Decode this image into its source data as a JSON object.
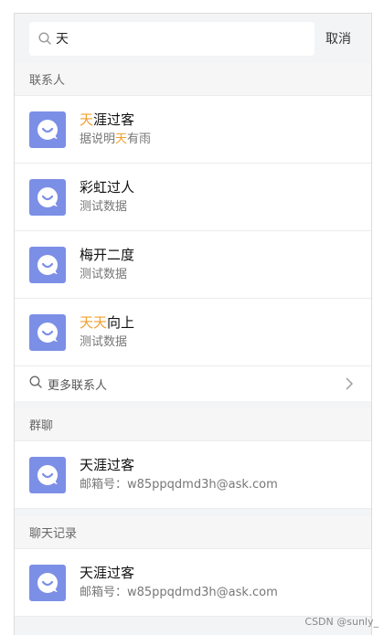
{
  "search": {
    "value": "天",
    "cancel_label": "取消"
  },
  "sections": {
    "contacts": {
      "title": "联系人",
      "more_label": "更多联系人"
    },
    "groups": {
      "title": "群聊"
    },
    "history": {
      "title": "聊天记录"
    }
  },
  "contacts": [
    {
      "title_hl": "天",
      "title_rest": "涯过客",
      "sub_pre": "据说明",
      "sub_hl": "天",
      "sub_post": "有雨"
    },
    {
      "title_rest": "彩虹过人",
      "sub_pre": "测试数据"
    },
    {
      "title_rest": "梅开二度",
      "sub_pre": "测试数据"
    },
    {
      "title_hl": "天天",
      "title_rest": "向上",
      "sub_pre": "测试数据"
    }
  ],
  "groups": [
    {
      "title": "天涯过客",
      "sub": "邮箱号：w85ppqdmd3h@ask.com"
    }
  ],
  "history": [
    {
      "title": "天涯过客",
      "sub": "邮箱号：w85ppqdmd3h@ask.com"
    }
  ],
  "watermark": "CSDN @sunly_",
  "colors": {
    "highlight": "#f0a030",
    "avatar": "#7c8fe6"
  },
  "icons": {
    "search": "search-icon",
    "avatar": "chat-bubble-icon",
    "more": "search-icon",
    "chevron": "chevron-right-icon"
  }
}
